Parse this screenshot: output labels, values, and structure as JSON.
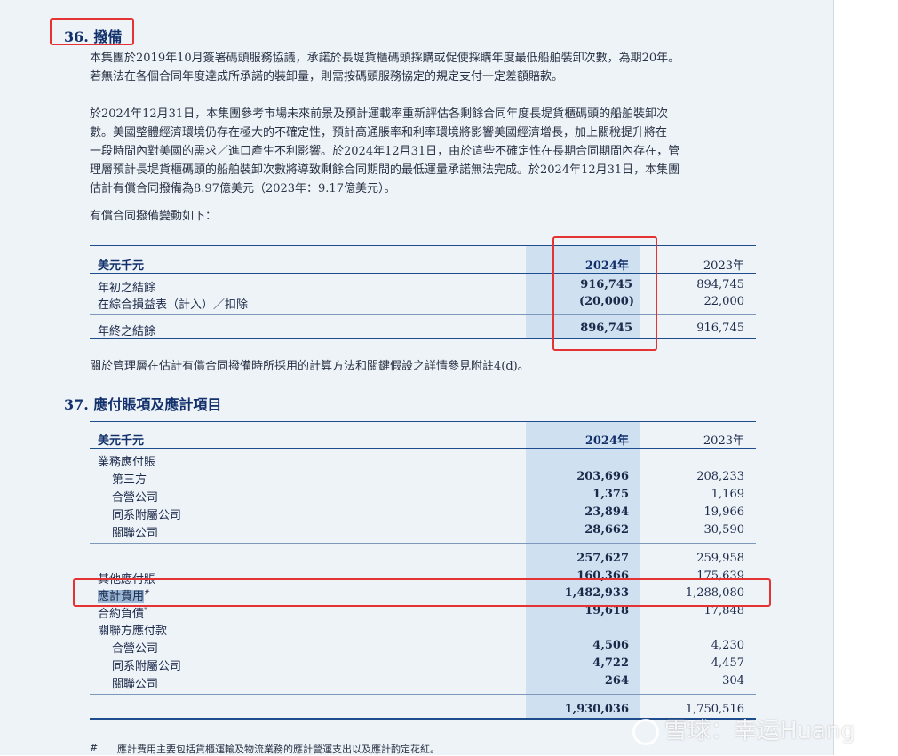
{
  "section36": {
    "number": "36.",
    "title": "撥備",
    "para1": [
      "本集團於2019年10月簽署碼頭服務協議，承諾於長堤貨櫃碼頭採購或促使採購年度最低船舶裝卸次數，為期20年。",
      "若無法在各個合同年度達成所承諾的裝卸量，則需按碼頭服務協定的規定支付一定差額賠款。"
    ],
    "para2": [
      "於2024年12月31日，本集團參考市場未來前景及預計運載率重新評估各剩餘合同年度長堤貨櫃碼頭的船舶裝卸次",
      "數。美國整體經濟環境仍存在極大的不確定性，預計高通脹率和利率環境將影響美國經濟增長，加上關稅提升將在",
      "一段時間內對美國的需求／進口產生不利影響。於2024年12月31日，由於這些不確定性在長期合同期間內存在，管",
      "理層預計長堤貨櫃碼頭的船舶裝卸次數將導致剩餘合同期間的最低運量承諾無法完成。於2024年12月31日，本集團",
      "估計有償合同撥備為8.97億美元（2023年：9.17億美元）。"
    ],
    "para3": "有償合同撥備變動如下：",
    "table": {
      "unit": "美元千元",
      "col_2024": "2024年",
      "col_2023": "2023年",
      "rows": [
        {
          "label": "年初之結餘",
          "v2024": "916,745",
          "v2023": "894,745"
        },
        {
          "label": "在綜合損益表（計入）／扣除",
          "v2024": "(20,000)",
          "v2023": "22,000"
        },
        {
          "label": "年終之結餘",
          "v2024": "896,745",
          "v2023": "916,745"
        }
      ]
    },
    "note": "關於管理層在估計有償合同撥備時所採用的計算方法和關鍵假設之詳情參見附註4(d)。"
  },
  "section37": {
    "number": "37.",
    "title": "應付賬項及應計項目",
    "table": {
      "unit": "美元千元",
      "col_2024": "2024年",
      "col_2023": "2023年",
      "trade_payables_label": "業務應付賬",
      "trade_rows": [
        {
          "label": "第三方",
          "v2024": "203,696",
          "v2023": "208,233"
        },
        {
          "label": "合營公司",
          "v2024": "1,375",
          "v2023": "1,169"
        },
        {
          "label": "同系附屬公司",
          "v2024": "23,894",
          "v2023": "19,966"
        },
        {
          "label": "關聯公司",
          "v2024": "28,662",
          "v2023": "30,590"
        }
      ],
      "trade_subtotal": {
        "v2024": "257,627",
        "v2023": "259,958"
      },
      "other_rows": [
        {
          "label": "其他應付賬",
          "v2024": "160,366",
          "v2023": "175,639"
        },
        {
          "label": "應計費用",
          "mark": "#",
          "v2024": "1,482,933",
          "v2023": "1,288,080"
        },
        {
          "label": "合約負債",
          "mark": "*",
          "v2024": "19,618",
          "v2023": "17,848"
        }
      ],
      "related_label": "關聯方應付款",
      "related_rows": [
        {
          "label": "合營公司",
          "v2024": "4,506",
          "v2023": "4,230"
        },
        {
          "label": "同系附屬公司",
          "v2024": "4,722",
          "v2023": "4,457"
        },
        {
          "label": "關聯公司",
          "v2024": "264",
          "v2023": "304"
        }
      ],
      "total": {
        "v2024": "1,930,036",
        "v2023": "1,750,516"
      }
    },
    "footnote_mark": "#",
    "footnote": "應計費用主要包括貨櫃運輸及物流業務的應計營運支出以及應計酌定花紅。"
  },
  "watermark": "雪球：幸运Huang",
  "colors": {
    "annotation_box": "#e53232",
    "title_blue": "#12306b",
    "column_highlight": "#cfe0f0",
    "page_bg": "#eef3f8"
  }
}
